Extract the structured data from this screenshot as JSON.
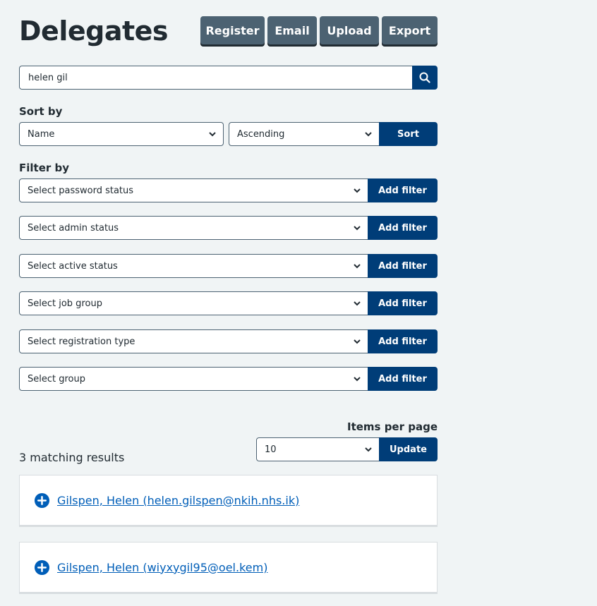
{
  "page": {
    "title": "Delegates"
  },
  "actions": [
    "Register",
    "Email",
    "Upload",
    "Export"
  ],
  "search": {
    "value": "helen gil",
    "button_icon": "search-icon"
  },
  "sort": {
    "label": "Sort by",
    "field_value": "Name",
    "direction_value": "Ascending",
    "button": "Sort"
  },
  "filter": {
    "label": "Filter by",
    "rows": [
      {
        "placeholder": "Select password status",
        "button": "Add filter"
      },
      {
        "placeholder": "Select admin status",
        "button": "Add filter"
      },
      {
        "placeholder": "Select active status",
        "button": "Add filter"
      },
      {
        "placeholder": "Select job group",
        "button": "Add filter"
      },
      {
        "placeholder": "Select registration type",
        "button": "Add filter"
      },
      {
        "placeholder": "Select group",
        "button": "Add filter"
      }
    ]
  },
  "pagination": {
    "label": "Items per page",
    "value": "10",
    "button": "Update"
  },
  "results": {
    "count_text": "3 matching results",
    "items": [
      {
        "text": "Gilspen, Helen (helen.gilspen@nkih.nhs.ik)"
      },
      {
        "text": "Gilspen, Helen (wiyxygil95@oel.kem)"
      }
    ]
  },
  "colors": {
    "primary": "#003d78",
    "secondary": "#4c6272",
    "link": "#005eb8",
    "background": "#f0f4f5"
  }
}
